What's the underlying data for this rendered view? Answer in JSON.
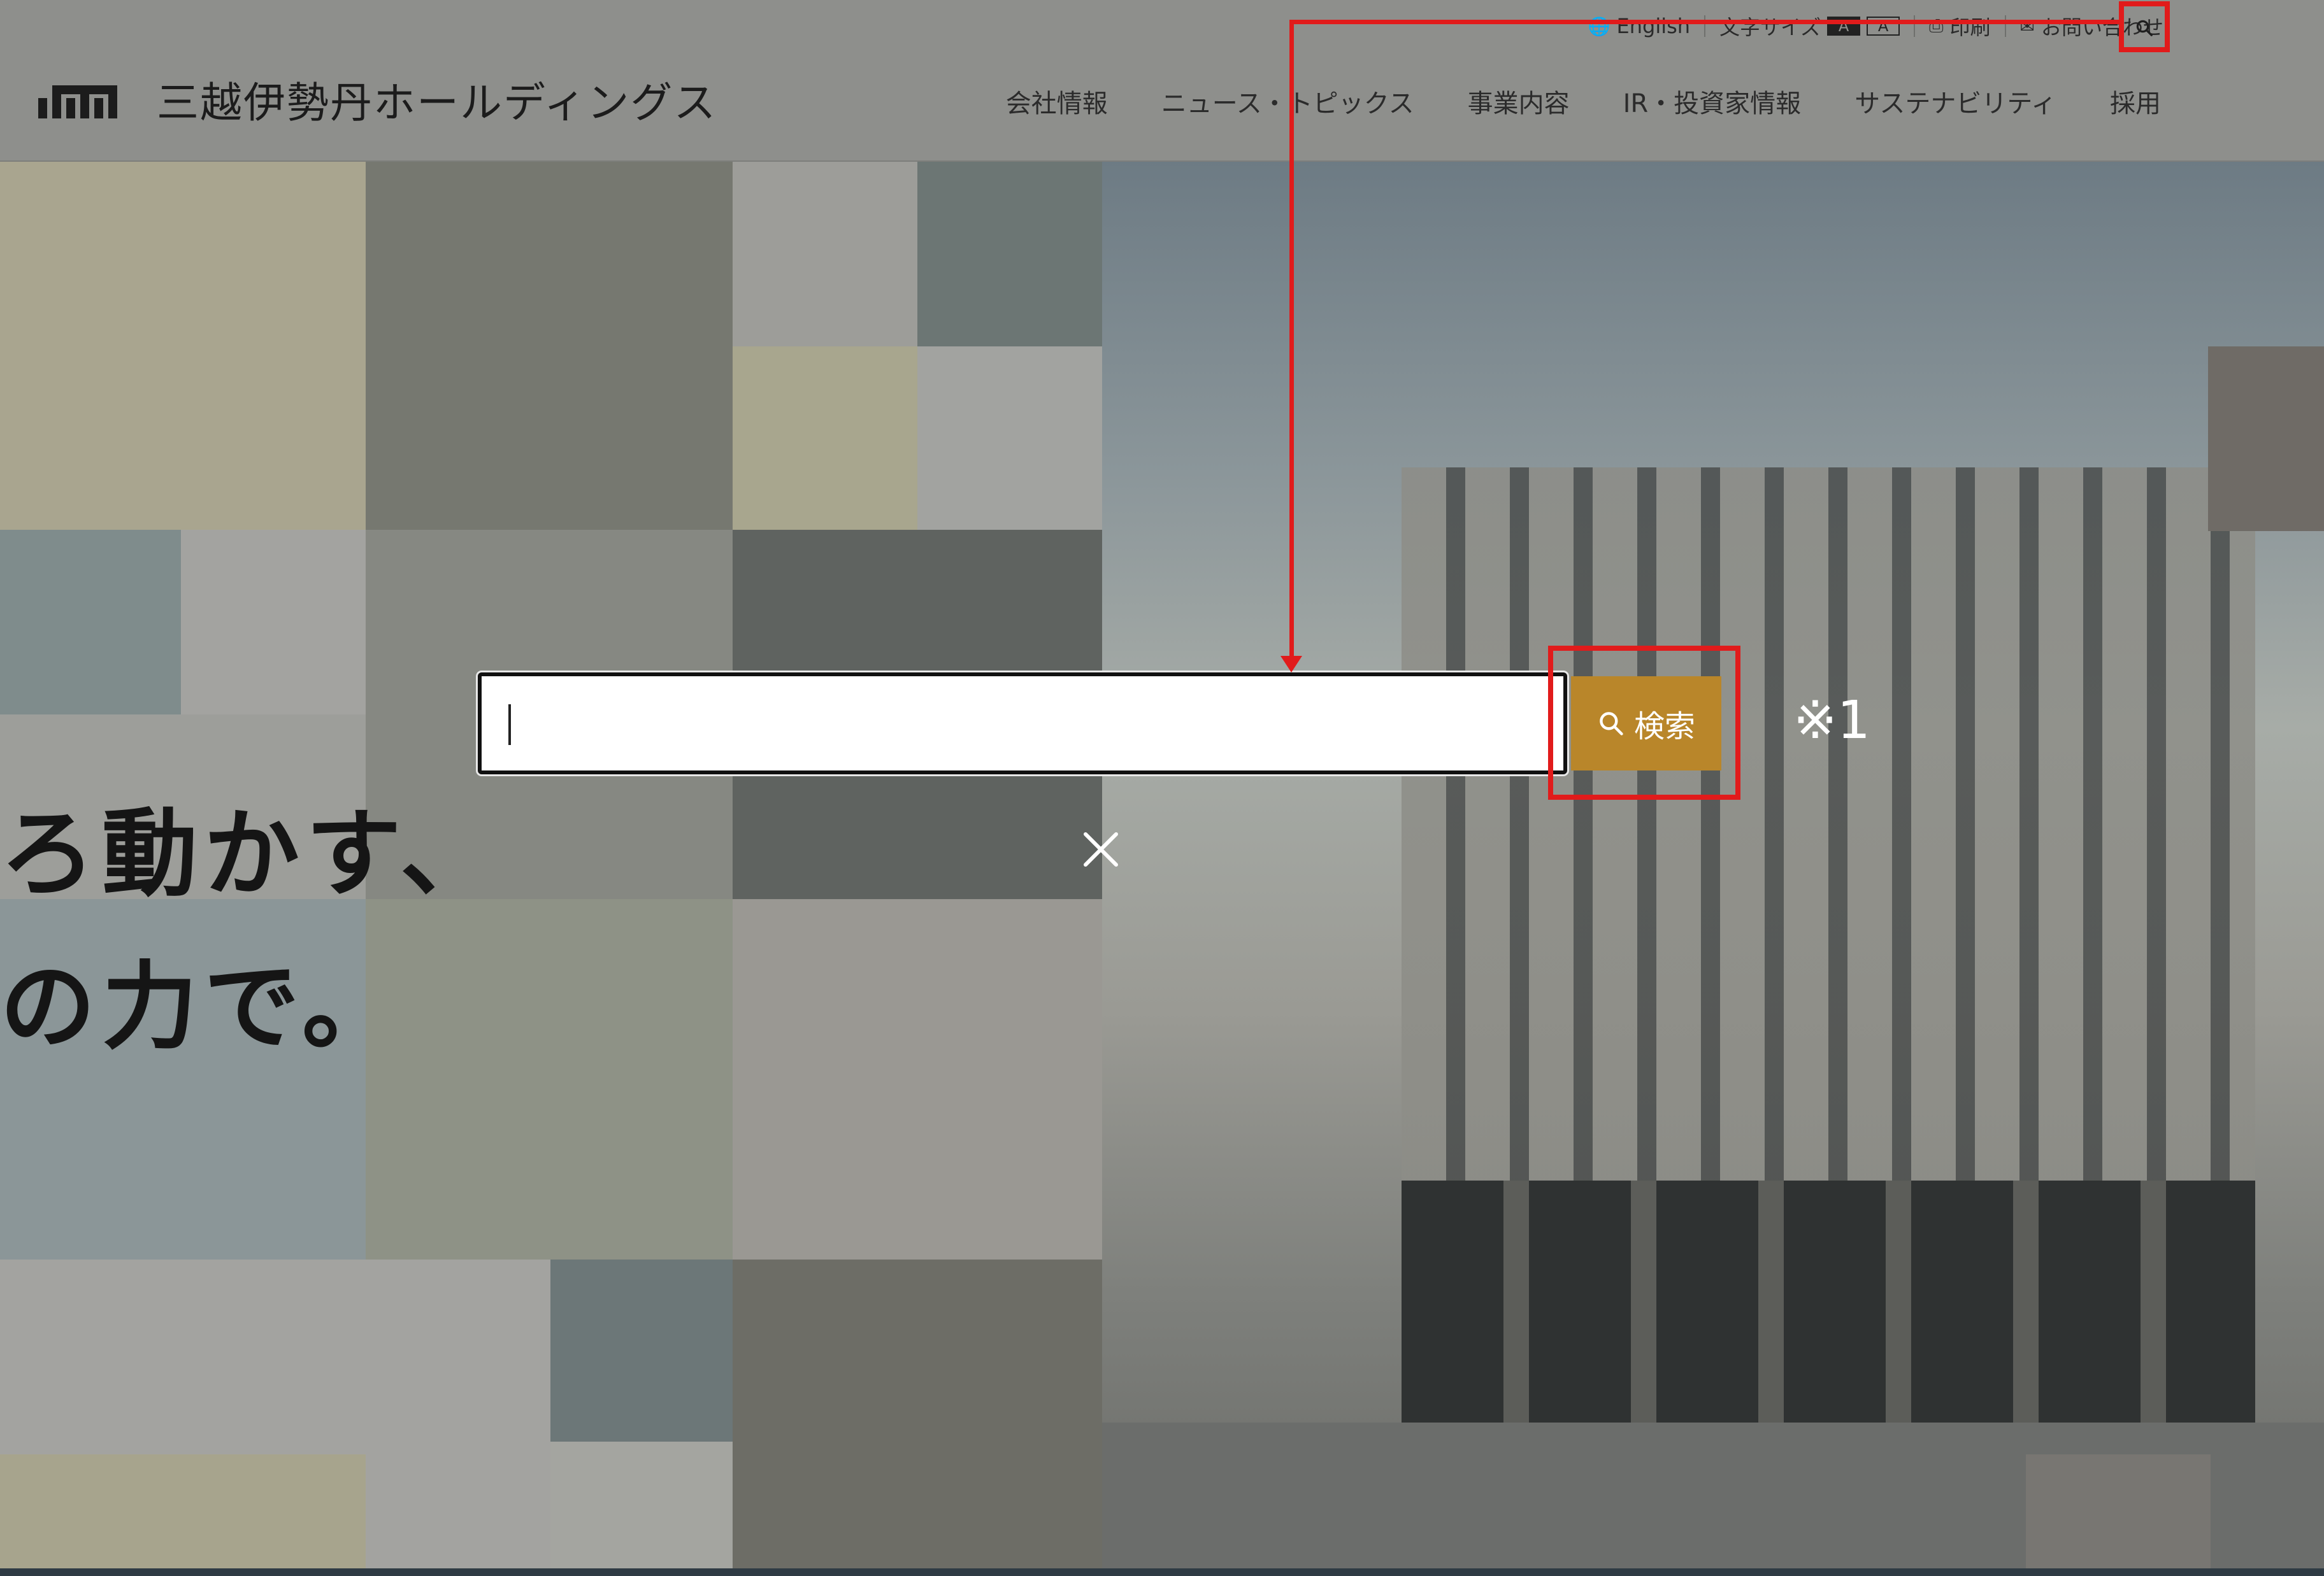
{
  "header": {
    "logo_text": "三越伊勢丹ホールディングス",
    "utility": {
      "english_label": "English",
      "font_size_label": "文字サイズ",
      "font_size_options": [
        "A",
        "A"
      ],
      "print_label": "印刷",
      "contact_label": "お問い合わせ"
    },
    "nav": [
      {
        "label": "会社情報"
      },
      {
        "label": "ニュース・トピックス"
      },
      {
        "label": "事業内容"
      },
      {
        "label": "IR・投資家情報"
      },
      {
        "label": "サステナビリティ"
      },
      {
        "label": "採用"
      }
    ]
  },
  "hero": {
    "line1": "ろ動かす、",
    "line2": "の力で。"
  },
  "search": {
    "input_value": "",
    "button_label": "検索",
    "close_label": "×"
  },
  "annotation": {
    "note_label": "※1",
    "color": "#e11b1b"
  },
  "colors": {
    "accent": "#b9862a",
    "overlay": "#8e8f8c"
  }
}
